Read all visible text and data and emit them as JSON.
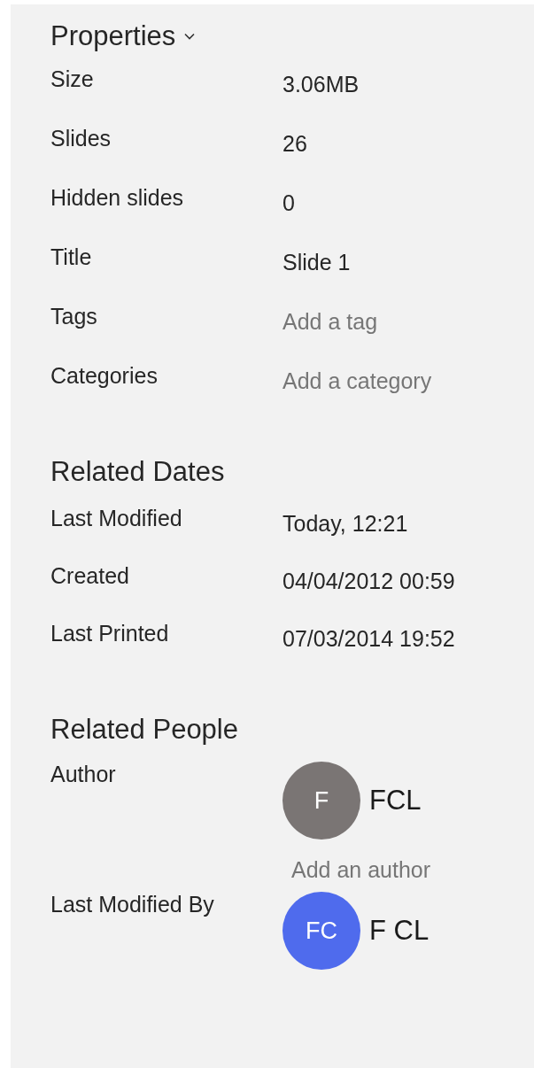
{
  "properties": {
    "title": "Properties",
    "rows": [
      {
        "label": "Size",
        "kind": "value",
        "text": "3.06MB"
      },
      {
        "label": "Slides",
        "kind": "value",
        "text": "26"
      },
      {
        "label": "Hidden slides",
        "kind": "value",
        "text": "0"
      },
      {
        "label": "Title",
        "kind": "value",
        "text": "Slide 1"
      },
      {
        "label": "Tags",
        "kind": "add",
        "text": "Add a tag"
      },
      {
        "label": "Categories",
        "kind": "add",
        "text": "Add a category"
      }
    ]
  },
  "related_dates": {
    "title": "Related Dates",
    "rows": [
      {
        "label": "Last Modified",
        "text": "Today, 12:21"
      },
      {
        "label": "Created",
        "text": "04/04/2012 00:59"
      },
      {
        "label": "Last Printed",
        "text": "07/03/2014 19:52"
      }
    ]
  },
  "related_people": {
    "title": "Related People",
    "groups": [
      {
        "label": "Author",
        "people": [
          {
            "initials": "F",
            "name": "FCL",
            "color": "#7a7574"
          }
        ],
        "add_link": "Add an author"
      },
      {
        "label": "Last Modified By",
        "people": [
          {
            "initials": "FC",
            "name": "F CL",
            "color": "#4f6bed"
          }
        ]
      }
    ]
  }
}
